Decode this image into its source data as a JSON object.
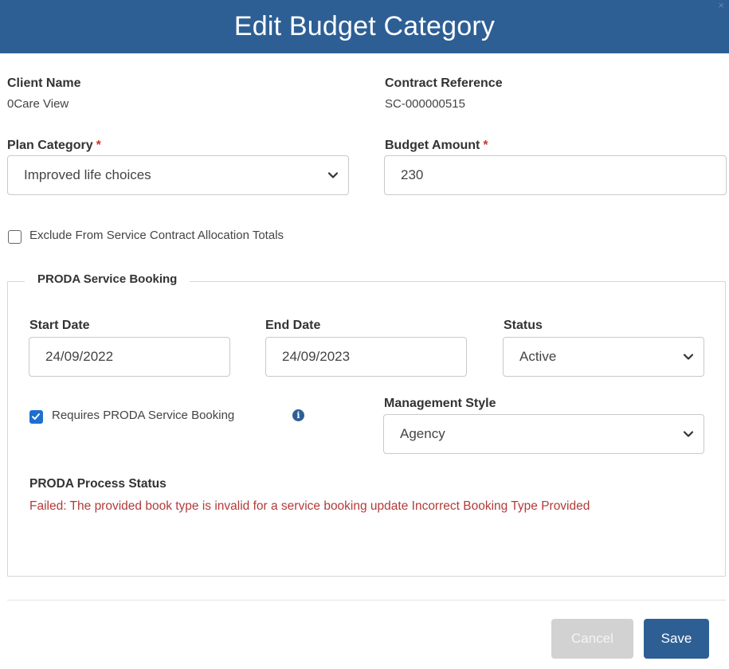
{
  "dialog": {
    "title": "Edit Budget Category",
    "close_glyph": "×"
  },
  "client": {
    "label": "Client Name",
    "value": "0Care View"
  },
  "contract": {
    "label": "Contract Reference",
    "value": "SC-000000515"
  },
  "plan_category": {
    "label": "Plan Category",
    "required_mark": "*",
    "selected": "Improved life choices"
  },
  "budget_amount": {
    "label": "Budget Amount",
    "required_mark": "*",
    "value": "230"
  },
  "exclude": {
    "label": "Exclude From Service Contract Allocation Totals",
    "checked": false
  },
  "proda": {
    "legend": "PRODA Service Booking",
    "start_date": {
      "label": "Start Date",
      "value": "24/09/2022"
    },
    "end_date": {
      "label": "End Date",
      "value": "24/09/2023"
    },
    "status": {
      "label": "Status",
      "selected": "Active"
    },
    "requires": {
      "label": "Requires PRODA Service Booking",
      "checked": true,
      "info_glyph": "i"
    },
    "management_style": {
      "label": "Management Style",
      "selected": "Agency"
    },
    "process_status": {
      "label": "PRODA Process Status",
      "message": "Failed: The provided book type is invalid for a service booking update Incorrect Booking Type Provided"
    }
  },
  "footer": {
    "cancel_label": "Cancel",
    "save_label": "Save"
  },
  "colors": {
    "header": "#2d5f95",
    "error": "#b33a3a",
    "checkbox_checked": "#1e6fd0"
  },
  "icons": {
    "close": "close-icon",
    "chevron": "chevron-down-icon",
    "info": "info-icon",
    "check": "checkmark-icon"
  }
}
